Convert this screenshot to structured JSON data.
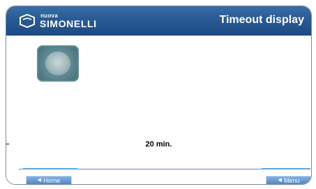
{
  "brand": {
    "small": "nuova",
    "name": "SIMONELLI"
  },
  "header": {
    "title": "Timeout display"
  },
  "main": {
    "timeout_value": "20 min."
  },
  "footer": {
    "left_button": "Home",
    "right_button": "Menu"
  },
  "colors": {
    "header": "#2a5a93",
    "button": "#4b7fbe",
    "accent": "#58a7e0"
  }
}
